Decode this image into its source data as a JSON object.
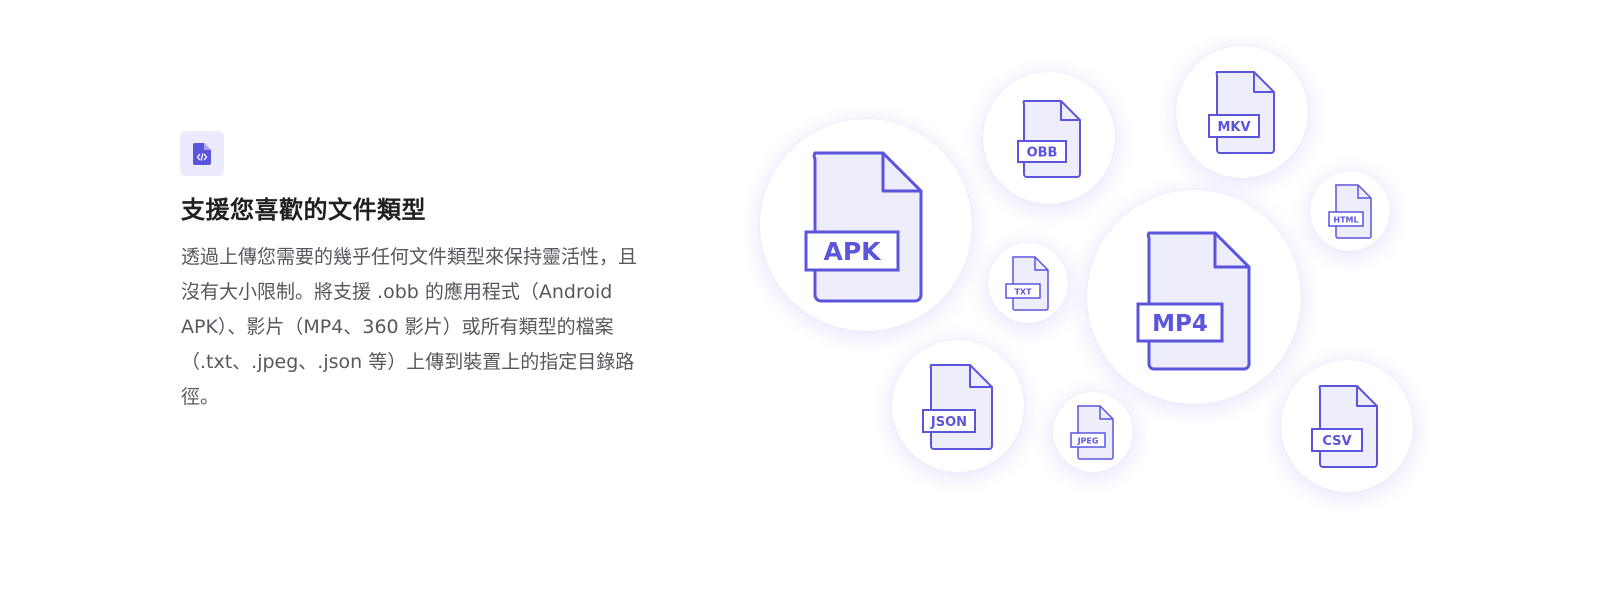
{
  "feature": {
    "icon": "code-file-icon",
    "title": "支援您喜歡的文件類型",
    "description": "透過上傳您需要的幾乎任何文件類型來保持靈活性，且沒有大小限制。將支援 .obb 的應用程式（Android APK）、影片（MP4、360 影片）或所有類型的檔案（.txt、.jpeg、.json 等）上傳到裝置上的指定目錄路徑。"
  },
  "file_types": {
    "apk": "APK",
    "obb": "OBB",
    "mkv": "MKV",
    "html": "HTML",
    "txt": "TXT",
    "mp4": "MP4",
    "json": "JSON",
    "jpeg": "JPEG",
    "csv": "CSV"
  },
  "colors": {
    "accent": "#5b55dc",
    "file_fill": "#eeedfc",
    "icon_bg": "#eceafd",
    "title": "#1f1f24",
    "body_text": "#57575f"
  }
}
